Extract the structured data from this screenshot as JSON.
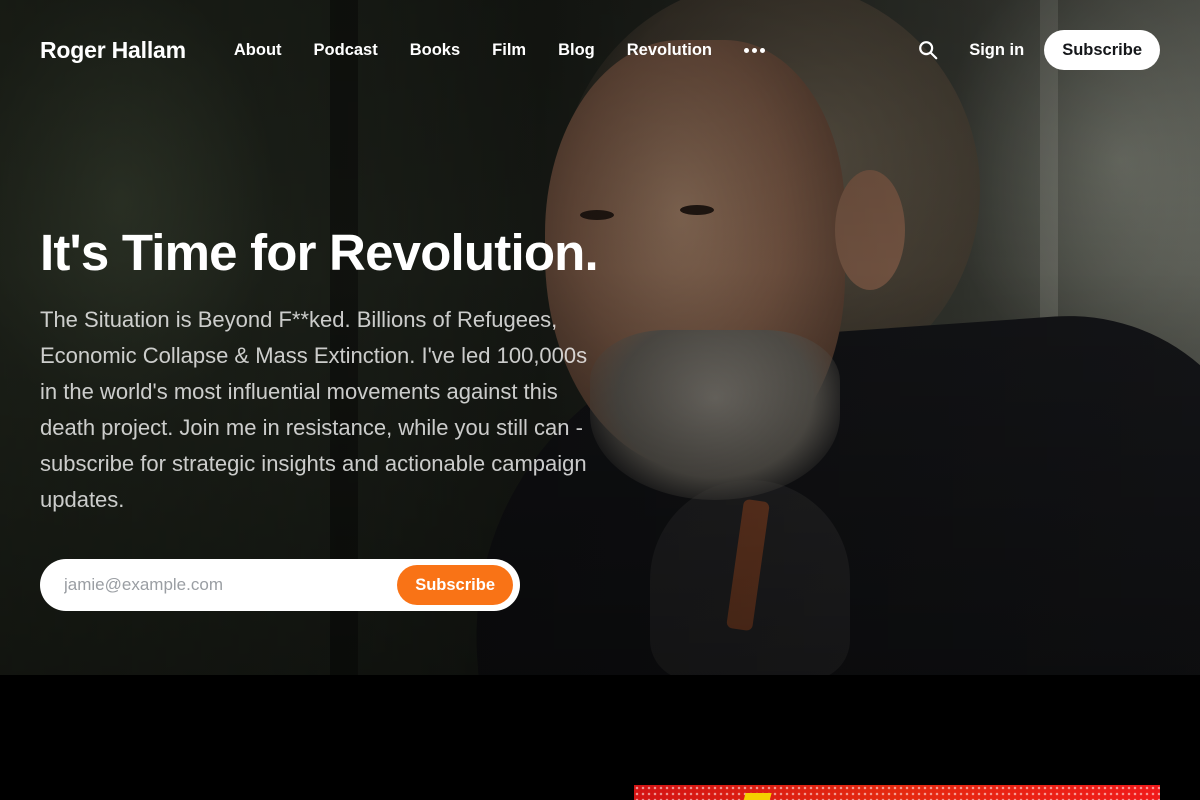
{
  "header": {
    "brand": "Roger Hallam",
    "nav": [
      {
        "label": "About"
      },
      {
        "label": "Podcast"
      },
      {
        "label": "Books"
      },
      {
        "label": "Film"
      },
      {
        "label": "Blog"
      },
      {
        "label": "Revolution"
      }
    ],
    "more_icon": "more-horizontal-icon",
    "search_icon": "search-icon",
    "signin_label": "Sign in",
    "subscribe_label": "Subscribe"
  },
  "hero": {
    "title": "It's Time for Revolution.",
    "description": "The Situation is Beyond F**ked. Billions of Refugees, Economic Collapse & Mass Extinction. I've led 100,000s in the world's most influential movements against this death project. Join me in resistance, while you still can - subscribe for strategic insights and actionable campaign updates.",
    "form": {
      "placeholder": "jamie@example.com",
      "button_label": "Subscribe"
    }
  },
  "colors": {
    "accent": "#f97316",
    "header_button_bg": "#ffffff",
    "page_bg": "#000000",
    "feature_image_red": "#e52a10"
  }
}
